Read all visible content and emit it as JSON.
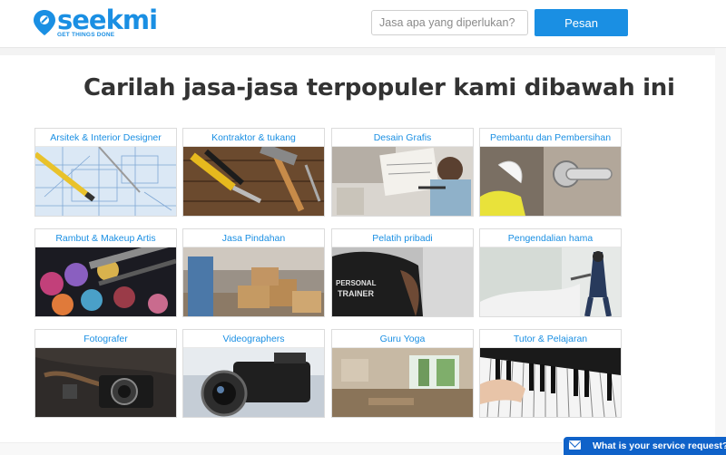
{
  "header": {
    "logo_text": "seekmi",
    "logo_tagline": "GET THINGS DONE",
    "search_placeholder": "Jasa apa yang diperlukan?",
    "search_value": "",
    "pesan_label": "Pesan",
    "brand_color": "#1a8fe3"
  },
  "main": {
    "title": "Carilah jasa-jasa terpopuler kami dibawah ini",
    "categories": [
      {
        "label": "Arsitek & Interior Designer",
        "icon": "blueprint-image"
      },
      {
        "label": "Kontraktor & tukang",
        "icon": "tools-image"
      },
      {
        "label": "Desain Grafis",
        "icon": "designer-desk-image"
      },
      {
        "label": "Pembantu dan Pembersihan",
        "icon": "cleaning-image"
      },
      {
        "label": "Rambut & Makeup Artis",
        "icon": "makeup-palette-image"
      },
      {
        "label": "Jasa Pindahan",
        "icon": "moving-boxes-image"
      },
      {
        "label": "Pelatih pribadi",
        "icon": "personal-trainer-image"
      },
      {
        "label": "Pengendalian hama",
        "icon": "pest-control-image"
      },
      {
        "label": "Fotografer",
        "icon": "camera-image"
      },
      {
        "label": "Videographers",
        "icon": "video-camera-image"
      },
      {
        "label": "Guru Yoga",
        "icon": "yoga-room-image"
      },
      {
        "label": "Tutor & Pelajaran",
        "icon": "piano-image"
      }
    ]
  },
  "chat": {
    "label": "What is your service request?",
    "icon": "envelope-icon"
  }
}
